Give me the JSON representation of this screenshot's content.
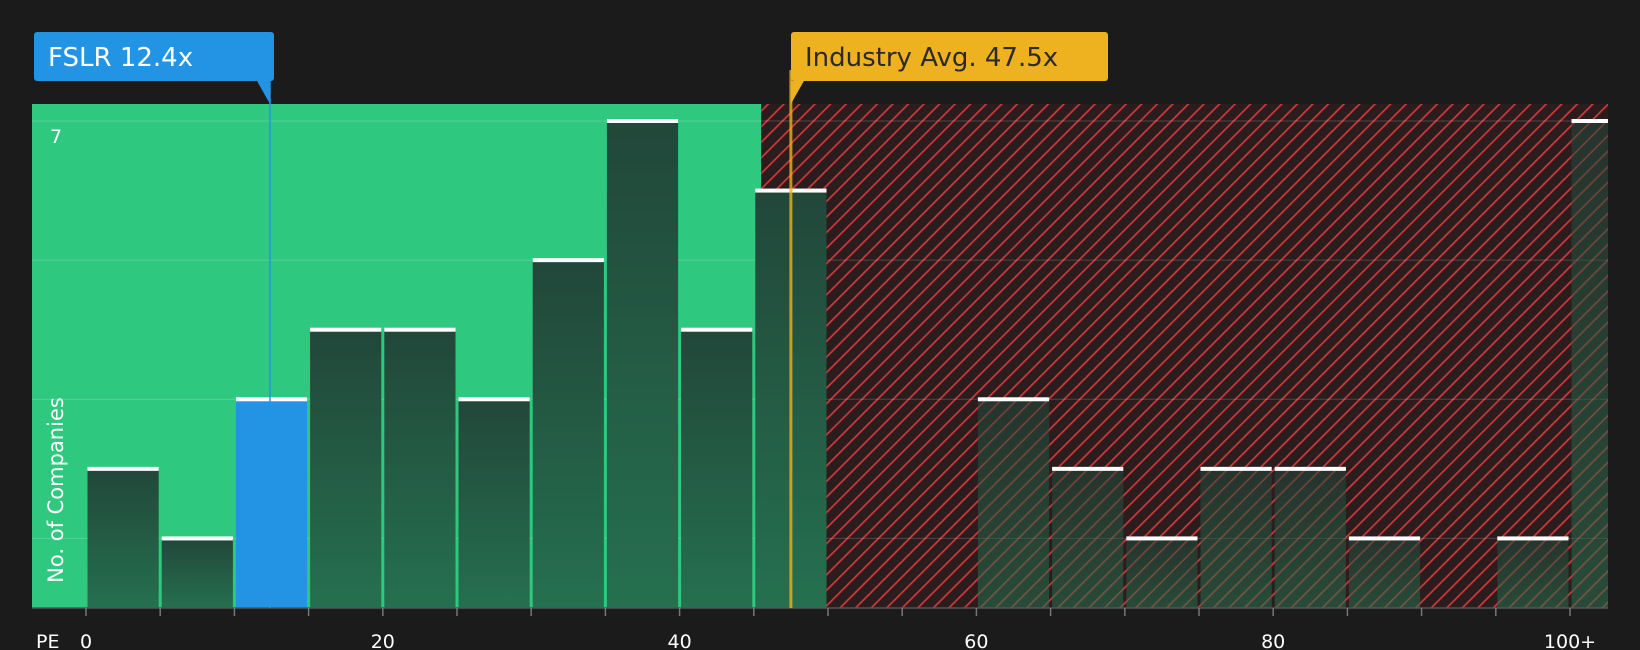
{
  "chart_data": {
    "type": "bar",
    "x_axis_prefix": "PE",
    "ylabel": "No. of Companies",
    "xlim": [
      -3.5,
      103
    ],
    "ylim": [
      0,
      7.25
    ],
    "bin_width": 5,
    "y_tick_labels": [
      {
        "value": 7,
        "label": "7"
      }
    ],
    "x_tick_labels": [
      {
        "value": 0,
        "label": "0"
      },
      {
        "value": 20,
        "label": "20"
      },
      {
        "value": 40,
        "label": "40"
      },
      {
        "value": 60,
        "label": "60"
      },
      {
        "value": 80,
        "label": "80"
      },
      {
        "value": 100,
        "label": "100+"
      }
    ],
    "minor_ticks": [
      0,
      5,
      10,
      15,
      20,
      25,
      30,
      35,
      40,
      45,
      50,
      55,
      60,
      65,
      70,
      75,
      80,
      85,
      90,
      95,
      100
    ],
    "bins": [
      {
        "start": 0,
        "count": 2
      },
      {
        "start": 5,
        "count": 1
      },
      {
        "start": 10,
        "count": 3,
        "highlight": true
      },
      {
        "start": 15,
        "count": 4
      },
      {
        "start": 20,
        "count": 4
      },
      {
        "start": 25,
        "count": 3
      },
      {
        "start": 30,
        "count": 5
      },
      {
        "start": 35,
        "count": 7
      },
      {
        "start": 40,
        "count": 4
      },
      {
        "start": 45,
        "count": 6
      },
      {
        "start": 60,
        "count": 3
      },
      {
        "start": 65,
        "count": 2
      },
      {
        "start": 70,
        "count": 1
      },
      {
        "start": 75,
        "count": 2
      },
      {
        "start": 80,
        "count": 2
      },
      {
        "start": 85,
        "count": 1
      },
      {
        "start": 95,
        "count": 1
      },
      {
        "start": 100,
        "count": 7
      }
    ],
    "fair_zone_end": 45.5,
    "markers": [
      {
        "label": "FSLR 12.4x",
        "value": 12.4,
        "color": "#2394e4",
        "text_color": "#ffffff"
      },
      {
        "label": "Industry Avg. 47.5x",
        "value": 47.5,
        "color": "#eeb11f",
        "text_color": "#2a2a2a"
      }
    ],
    "colors": {
      "background": "#1b1b1b",
      "fair_zone": "#2ec87e",
      "overvalued_hatch": "#d0383a",
      "overvalued_bg": "#2b1d1d",
      "bar_dark_top": "#22473a",
      "bar_dark_bottom": "#25704f",
      "highlight_bar": "#2394e4",
      "bar_cap": "#ffffff"
    }
  }
}
